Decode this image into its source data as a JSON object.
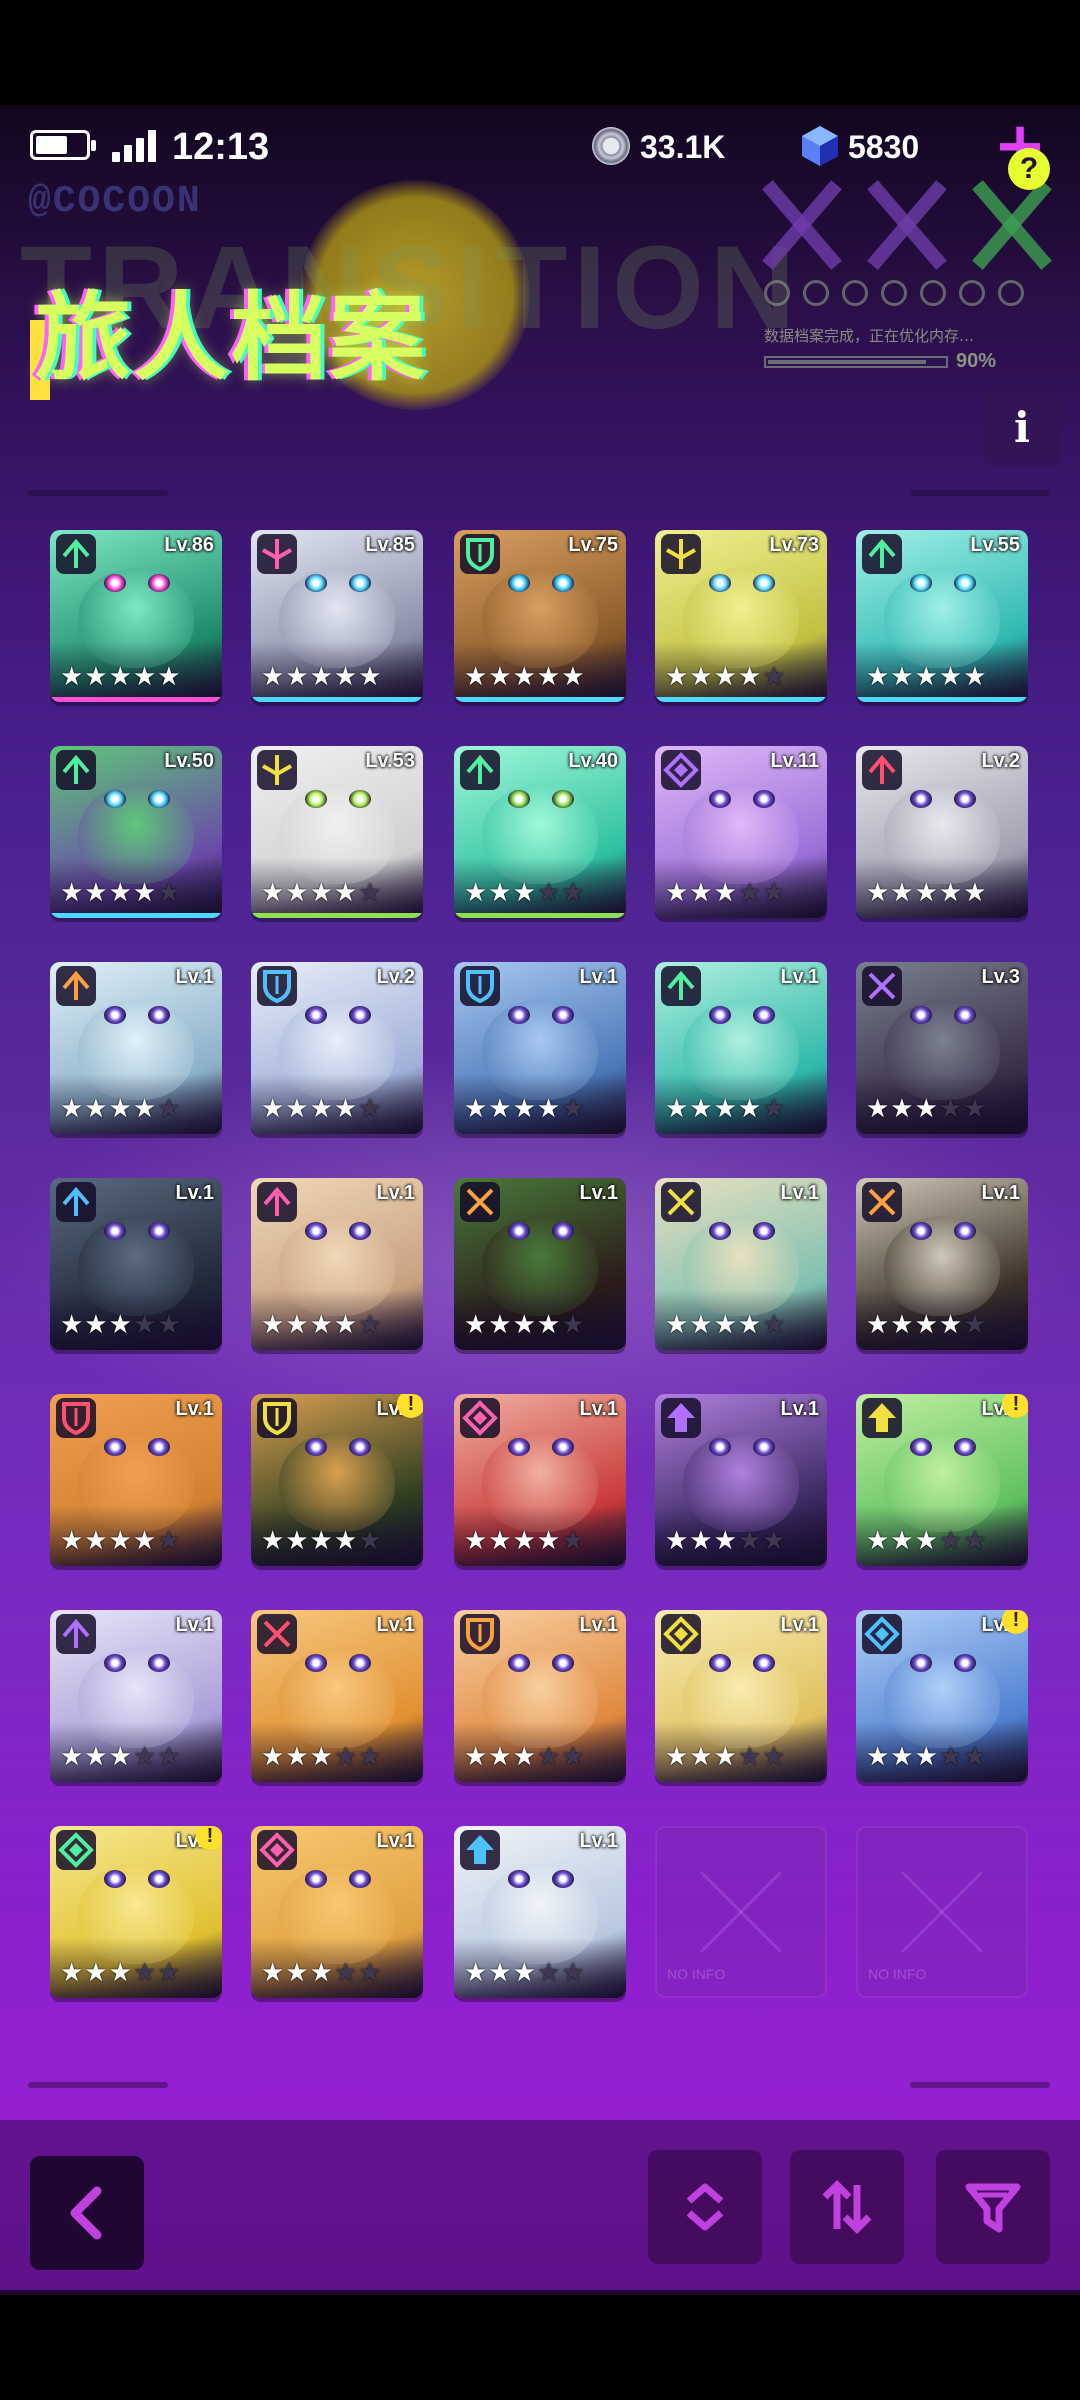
{
  "status_bar": {
    "time": "12:13",
    "battery_level": 0.65
  },
  "currencies": {
    "coins": "33.1K",
    "coin_icon": "silver-coin-icon",
    "gems": "5830",
    "gem_icon": "blue-cube-gem-icon"
  },
  "header": {
    "title": "旅人档案",
    "background_text": "TRANSITION",
    "brand_text": "@COCOON",
    "status_text": "数据档案完成，正在优化内存…",
    "progress_percent": "90%",
    "progress_value": 0.9,
    "help_label": "?",
    "info_label": "i"
  },
  "roster": [
    {
      "level": "Lv.86",
      "stars": 5,
      "max_stars": 5,
      "role": "green-up-role-icon",
      "alert": false,
      "palette": [
        "#1f8a6a",
        "#7ee8c4",
        "#ff4fd8"
      ]
    },
    {
      "level": "Lv.85",
      "stars": 5,
      "max_stars": 5,
      "role": "pink-wing-role-icon",
      "alert": false,
      "palette": [
        "#8a8fa8",
        "#e2e6f2",
        "#4fd8ff"
      ]
    },
    {
      "level": "Lv.75",
      "stars": 5,
      "max_stars": 5,
      "role": "green-shield-role-icon",
      "alert": false,
      "palette": [
        "#8a5a2a",
        "#d8a060",
        "#3fd0ff"
      ]
    },
    {
      "level": "Lv.73",
      "stars": 4,
      "max_stars": 5,
      "role": "yellow-cross-role-icon",
      "alert": false,
      "palette": [
        "#c0c040",
        "#f0f090",
        "#5fd8ff"
      ]
    },
    {
      "level": "Lv.55",
      "stars": 5,
      "max_stars": 5,
      "role": "green-arrow-role-icon",
      "alert": false,
      "palette": [
        "#2fb8b0",
        "#a0f0e8",
        "#4fe0ff"
      ]
    },
    {
      "level": "Lv.50",
      "stars": 4,
      "max_stars": 5,
      "role": "green-up-role-icon",
      "alert": false,
      "palette": [
        "#6a4aa8",
        "#5ec878",
        "#4fd8ff"
      ]
    },
    {
      "level": "Lv.53",
      "stars": 4,
      "max_stars": 5,
      "role": "yellow-wing-role-icon",
      "alert": false,
      "palette": [
        "#d0d0d0",
        "#f0f0f0",
        "#b0f050"
      ]
    },
    {
      "level": "Lv.40",
      "stars": 3,
      "max_stars": 5,
      "role": "green-arrow-role-icon",
      "alert": false,
      "palette": [
        "#2fc0a0",
        "#a0f8d8",
        "#8fe050"
      ]
    },
    {
      "level": "Lv.11",
      "stars": 3,
      "max_stars": 5,
      "role": "purple-diamond-role-icon",
      "alert": false,
      "palette": [
        "#9a70d8",
        "#e0b8f8",
        "#ffffff"
      ]
    },
    {
      "level": "Lv.2",
      "stars": 5,
      "max_stars": 5,
      "role": "red-arrow-role-icon",
      "alert": false,
      "palette": [
        "#a0a0b0",
        "#e8e8ee",
        "#ffffff"
      ]
    },
    {
      "level": "Lv.1",
      "stars": 4,
      "max_stars": 5,
      "role": "orange-arrow-role-icon",
      "alert": false,
      "palette": [
        "#8ab0c8",
        "#e0f0f8",
        "#ffffff"
      ]
    },
    {
      "level": "Lv.2",
      "stars": 4,
      "max_stars": 5,
      "role": "blue-shield-role-icon",
      "alert": false,
      "palette": [
        "#a0b0d8",
        "#e8eef8",
        "#ffffff"
      ]
    },
    {
      "level": "Lv.1",
      "stars": 4,
      "max_stars": 5,
      "role": "blue-shield-role-icon",
      "alert": false,
      "palette": [
        "#4a78b8",
        "#a8c8f0",
        "#ffffff"
      ]
    },
    {
      "level": "Lv.1",
      "stars": 4,
      "max_stars": 5,
      "role": "green-up-role-icon",
      "alert": false,
      "palette": [
        "#2fb8a8",
        "#b0f0e0",
        "#ffffff"
      ]
    },
    {
      "level": "Lv.3",
      "stars": 3,
      "max_stars": 5,
      "role": "purple-swords-role-icon",
      "alert": false,
      "palette": [
        "#3a3048",
        "#7a8090",
        "#ffffff"
      ]
    },
    {
      "level": "Lv.1",
      "stars": 3,
      "max_stars": 5,
      "role": "blue-arrow-role-icon",
      "alert": false,
      "palette": [
        "#202838",
        "#5a6a80",
        "#ffffff"
      ]
    },
    {
      "level": "Lv.1",
      "stars": 4,
      "max_stars": 5,
      "role": "pink-arrow-role-icon",
      "alert": false,
      "palette": [
        "#c8a080",
        "#f0d8b8",
        "#ffffff"
      ]
    },
    {
      "level": "Lv.1",
      "stars": 4,
      "max_stars": 5,
      "role": "orange-swords-role-icon",
      "alert": false,
      "palette": [
        "#2a1a1a",
        "#4a7a3a",
        "#ffffff"
      ]
    },
    {
      "level": "Lv.1",
      "stars": 4,
      "max_stars": 5,
      "role": "yellow-swords-role-icon",
      "alert": false,
      "palette": [
        "#80c0b0",
        "#e8e0c0",
        "#ffffff"
      ]
    },
    {
      "level": "Lv.1",
      "stars": 4,
      "max_stars": 5,
      "role": "orange-swords-role-icon",
      "alert": false,
      "palette": [
        "#3a3028",
        "#d0c8b8",
        "#ffffff"
      ]
    },
    {
      "level": "Lv.1",
      "stars": 4,
      "max_stars": 5,
      "role": "red-shield-role-icon",
      "alert": false,
      "palette": [
        "#d08030",
        "#f0a050",
        "#ffffff"
      ]
    },
    {
      "level": "Lv.1",
      "stars": 4,
      "max_stars": 5,
      "role": "yellow-shield-role-icon",
      "alert": true,
      "palette": [
        "#2a3a20",
        "#d8a050",
        "#ffffff"
      ]
    },
    {
      "level": "Lv.1",
      "stars": 4,
      "max_stars": 5,
      "role": "pink-diamond-role-icon",
      "alert": false,
      "palette": [
        "#c83a3a",
        "#f0b0a0",
        "#ffffff"
      ]
    },
    {
      "level": "Lv.1",
      "stars": 3,
      "max_stars": 5,
      "role": "purple-arrow-up-role-icon",
      "alert": false,
      "palette": [
        "#3a2860",
        "#b080e0",
        "#ffffff"
      ]
    },
    {
      "level": "Lv.1",
      "stars": 3,
      "max_stars": 5,
      "role": "yellow-arrow-up-role-icon",
      "alert": true,
      "palette": [
        "#60c060",
        "#c0f0a0",
        "#ffffff"
      ]
    },
    {
      "level": "Lv.1",
      "stars": 3,
      "max_stars": 5,
      "role": "purple-arrow-role-icon",
      "alert": false,
      "palette": [
        "#a8a0d8",
        "#e8e4f8",
        "#ffffff"
      ]
    },
    {
      "level": "Lv.1",
      "stars": 3,
      "max_stars": 5,
      "role": "red-swords-role-icon",
      "alert": false,
      "palette": [
        "#e09030",
        "#f8c880",
        "#ffffff"
      ]
    },
    {
      "level": "Lv.1",
      "stars": 3,
      "max_stars": 5,
      "role": "orange-shield-role-icon",
      "alert": false,
      "palette": [
        "#e08840",
        "#f8d0a0",
        "#ffffff"
      ]
    },
    {
      "level": "Lv.1",
      "stars": 3,
      "max_stars": 5,
      "role": "yellow-diamond-role-icon",
      "alert": false,
      "palette": [
        "#e0c060",
        "#f8ecb0",
        "#ffffff"
      ]
    },
    {
      "level": "Lv.1",
      "stars": 3,
      "max_stars": 5,
      "role": "blue-diamond-role-icon",
      "alert": true,
      "palette": [
        "#5080d0",
        "#b0d0f8",
        "#ffffff"
      ]
    },
    {
      "level": "Lv.1",
      "stars": 3,
      "max_stars": 5,
      "role": "green-diamond-role-icon",
      "alert": true,
      "palette": [
        "#e0c030",
        "#f8e890",
        "#ffffff"
      ]
    },
    {
      "level": "Lv.1",
      "stars": 3,
      "max_stars": 5,
      "role": "pink-diamond-role-icon",
      "alert": false,
      "palette": [
        "#e0a040",
        "#f8c870",
        "#ffffff"
      ]
    },
    {
      "level": "Lv.1",
      "stars": 3,
      "max_stars": 5,
      "role": "blue-arrow-up-role-icon",
      "alert": false,
      "palette": [
        "#b8c8e0",
        "#f0f4f8",
        "#ffffff"
      ]
    }
  ],
  "empty_slots": [
    {
      "label": "NO INFO"
    },
    {
      "label": "NO INFO"
    }
  ],
  "bottom_bar": {
    "back_icon": "chevron-left-icon",
    "expand_icon": "expand-collapse-icon",
    "sort_icon": "sort-order-icon",
    "filter_icon": "filter-icon"
  },
  "colors": {
    "accent": "#e040fb",
    "title": "#d8ff60",
    "help": "#e8ff30",
    "alert": "#ffe02a",
    "underline_pink": "#ff4fd8",
    "underline_blue": "#4fd8ff",
    "underline_green": "#8fe050"
  }
}
